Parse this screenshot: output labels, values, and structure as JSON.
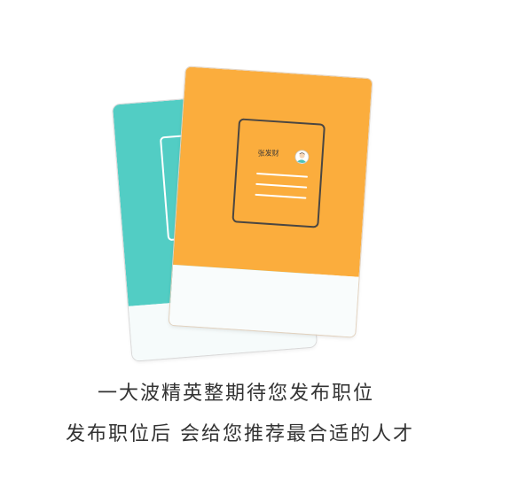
{
  "illustration": {
    "resume_name": "张发财",
    "colors": {
      "back_card": "#52cdc4",
      "front_card": "#fbad3d",
      "card_bottom": "#f9fcfc",
      "outline": "#4a4642"
    },
    "icons": [
      "avatar-icon"
    ]
  },
  "caption": {
    "line1": "一大波精英整期待您发布职位",
    "line2": "发布职位后 会给您推荐最合适的人才"
  }
}
